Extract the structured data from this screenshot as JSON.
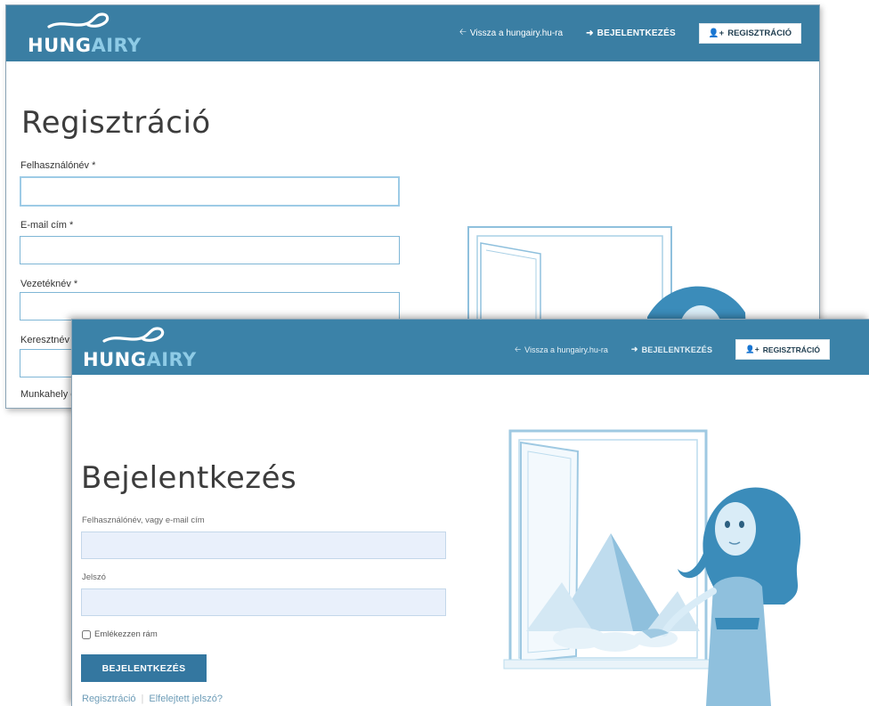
{
  "brand": {
    "logo_part1": "HUNG",
    "logo_part2": "AIRY"
  },
  "nav": {
    "back_link": "Vissza a hungairy.hu-ra",
    "login": "BEJELENTKEZÉS",
    "register": "REGISZTRÁCIÓ"
  },
  "register_page": {
    "title": "Regisztráció",
    "fields": [
      {
        "label": "Felhasználónév *",
        "value": ""
      },
      {
        "label": "E-mail cím *",
        "value": ""
      },
      {
        "label": "Vezetéknév *",
        "value": ""
      },
      {
        "label": "Keresztnév *",
        "value": ""
      },
      {
        "label": "Munkahely c",
        "value": ""
      }
    ]
  },
  "login_page": {
    "title": "Bejelentkezés",
    "username_label": "Felhasználónév, vagy e-mail cím",
    "password_label": "Jelszó",
    "remember_label": "Emlékezzen rám",
    "submit_label": "BEJELENTKEZÉS",
    "register_link": "Regisztráció",
    "forgot_link": "Elfelejtett jelszó?"
  },
  "colors": {
    "header": "#3a7ea3",
    "primary_button": "#3477a0",
    "illustration": "#3b8cba"
  }
}
